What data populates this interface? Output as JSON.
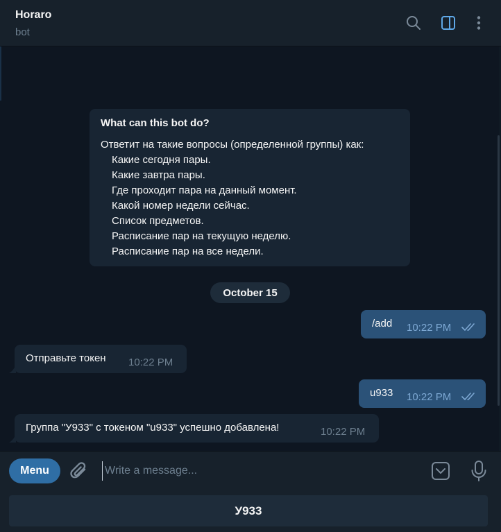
{
  "header": {
    "title": "Horaro",
    "subtitle": "bot",
    "icons": [
      "search-icon",
      "sidebar-toggle-icon",
      "more-vertical-icon"
    ]
  },
  "bot_info": {
    "title": "What can this bot do?",
    "lines": [
      "Ответит на такие вопросы (определенной группы) как:",
      "Какие сегодня пары.",
      "Какие завтра пары.",
      "Где проходит пара на данный момент.",
      "Какой номер недели сейчас.",
      "Список предметов.",
      "Расписание пар на текущую неделю.",
      "Расписание пар на все недели."
    ]
  },
  "date_separator": "October 15",
  "messages": [
    {
      "direction": "out",
      "text": "/add",
      "time": "10:22 PM",
      "status": "read"
    },
    {
      "direction": "in",
      "text": "Отправьте токен",
      "time": "10:22 PM"
    },
    {
      "direction": "out",
      "text": "u933",
      "time": "10:22 PM",
      "status": "read"
    },
    {
      "direction": "in",
      "text": "Группа \"У933\" с токеном \"u933\" успешно добавлена!",
      "time": "10:22 PM"
    }
  ],
  "composer": {
    "menu_label": "Menu",
    "placeholder": "Write a message...",
    "value": "",
    "icons": [
      "paperclip-icon",
      "bot-keyboard-icon",
      "microphone-icon"
    ]
  },
  "reply_keyboard": {
    "buttons": [
      "У933"
    ]
  },
  "colors": {
    "background": "#0e1621",
    "panel": "#17212b",
    "outgoing_bubble": "#2b5278",
    "incoming_bubble": "#182533",
    "accent": "#2f6ea5",
    "read_checks": "#7da8d3"
  }
}
